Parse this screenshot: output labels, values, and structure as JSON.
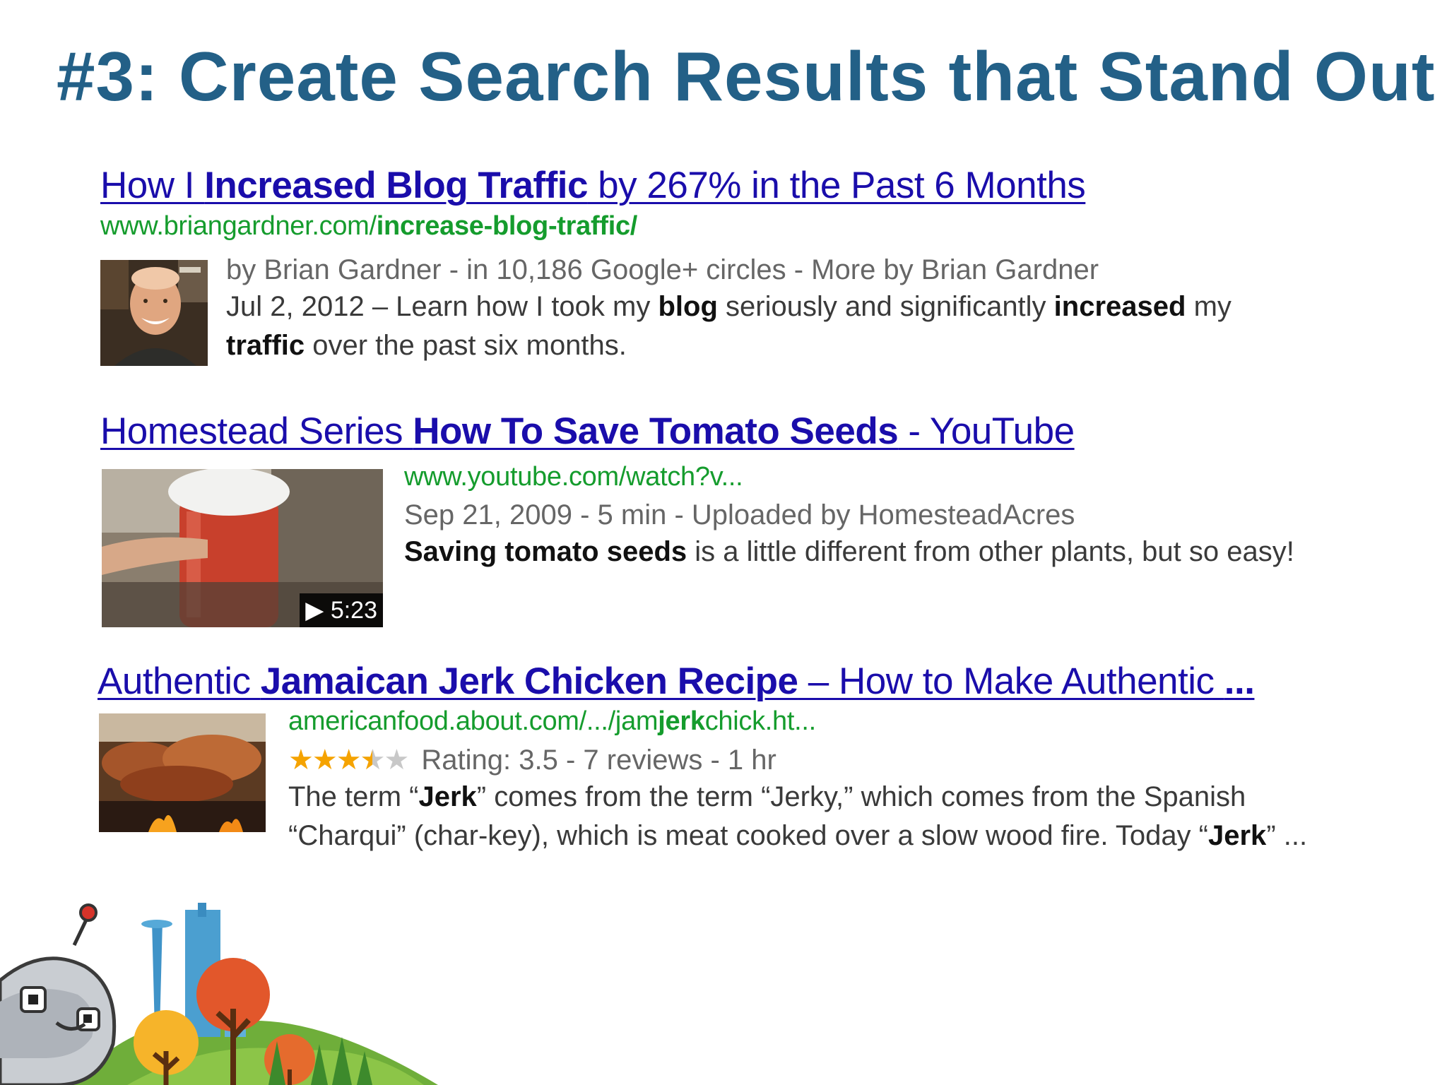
{
  "slide": {
    "title": "#3: Create Search Results that Stand Out"
  },
  "results": [
    {
      "title_parts": [
        "How I ",
        "Increased Blog Traffic",
        " by 267% in the Past 6 Months"
      ],
      "url_parts": [
        "www.briangardner.com/",
        "increase-blog-traffic/"
      ],
      "meta": "by Brian Gardner - in 10,186 Google+ circles - More by Brian Gardner",
      "snippet_parts": [
        "Jul 2, 2012 – Learn how I took my ",
        "blog",
        " seriously and significantly ",
        "increased",
        " my ",
        "traffic",
        " over the past six months."
      ]
    },
    {
      "title_parts": [
        "Homestead Series ",
        "How To Save Tomato Seeds",
        " - YouTube"
      ],
      "url": "www.youtube.com/watch?v...",
      "meta": "Sep 21, 2009 - 5 min - Uploaded by HomesteadAcres",
      "snippet_parts": [
        "Saving tomato seeds",
        " is a little different from other plants, but so easy!"
      ],
      "duration": "5:23"
    },
    {
      "title_parts": [
        "Authentic ",
        "Jamaican Jerk Chicken Recipe",
        " – How to Make Authentic ",
        "..."
      ],
      "url_parts": [
        "americanfood.about.com/.../jam",
        "jerk",
        "chick.ht..."
      ],
      "rating": 3.5,
      "rating_text": "Rating: 3.5 - 7 reviews - 1 hr",
      "snippet_parts": [
        "The term “",
        "Jerk",
        "” comes from the term “Jerky,” which comes from the Spanish “Charqui” (char-key), which is meat cooked over a slow wood fire. Today “",
        "Jerk",
        "” ..."
      ]
    }
  ],
  "colors": {
    "title": "#236087",
    "link": "#1a0dab",
    "url": "#159c2d",
    "star": "#f5a300"
  }
}
